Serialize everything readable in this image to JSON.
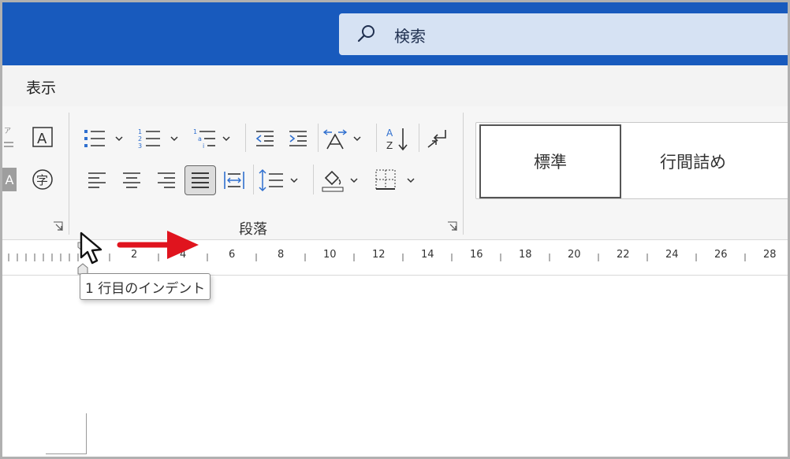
{
  "search": {
    "label": "検索",
    "icon": "search-icon"
  },
  "tabs": {
    "view_label": "表示"
  },
  "ribbon": {
    "paragraph_group_label": "段落",
    "partial_left_glyph": "A",
    "styles": [
      {
        "label": "標準",
        "selected": true
      },
      {
        "label": "行間詰め",
        "selected": false
      }
    ]
  },
  "ruler": {
    "labels": [
      "2",
      "4",
      "6",
      "8",
      "10",
      "12",
      "14",
      "16",
      "18",
      "20",
      "22",
      "24",
      "26",
      "28"
    ]
  },
  "tooltip": {
    "text": "1 行目のインデント"
  },
  "colors": {
    "titlebar": "#185abd",
    "search_bg": "#d6e2f3",
    "accent_blue": "#2f6fcf",
    "arrow_red": "#e0141e"
  }
}
